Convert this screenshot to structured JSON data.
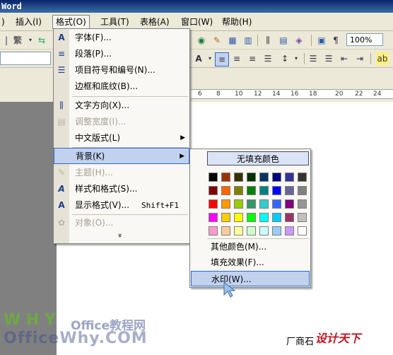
{
  "titlebar": {
    "title": "Word"
  },
  "menubar": {
    "items": [
      {
        "label": "插入(I)"
      },
      {
        "label": "格式(O)"
      },
      {
        "label": "工具(T)"
      },
      {
        "label": "表格(A)"
      },
      {
        "label": "窗口(W)"
      },
      {
        "label": "帮助(H)"
      }
    ]
  },
  "toolbar": {
    "font_variant": "繁",
    "zoom": "100%"
  },
  "ruler": {
    "ticks": [
      "6",
      "8",
      "10",
      "12",
      "14",
      "16",
      "18",
      "20",
      "22",
      "24"
    ]
  },
  "format_menu": {
    "items": [
      {
        "label": "字体(F)...",
        "icon": "font-icon",
        "glyph": "A",
        "disabled": false
      },
      {
        "label": "段落(P)...",
        "icon": "paragraph-icon",
        "glyph": "≡",
        "disabled": false
      },
      {
        "label": "项目符号和编号(N)...",
        "icon": "bullets-icon",
        "glyph": "☰",
        "disabled": false
      },
      {
        "label": "边框和底纹(B)...",
        "icon": "",
        "glyph": "",
        "disabled": false
      },
      {
        "label": "文字方向(X)...",
        "icon": "text-direction-icon",
        "glyph": "⫼",
        "disabled": false
      },
      {
        "label": "调整宽度(I)...",
        "icon": "adjust-width-icon",
        "glyph": "▤",
        "disabled": true
      },
      {
        "label": "中文版式(L)",
        "icon": "",
        "glyph": "",
        "disabled": false
      },
      {
        "label": "背景(K)",
        "icon": "",
        "glyph": "",
        "disabled": false
      },
      {
        "label": "主题(H)...",
        "icon": "theme-icon",
        "glyph": "✎",
        "disabled": true
      },
      {
        "label": "样式和格式(S)...",
        "icon": "styles-icon",
        "glyph": "A",
        "disabled": false
      },
      {
        "label": "显示格式(V)...",
        "icon": "reveal-format-icon",
        "glyph": "A",
        "disabled": false
      },
      {
        "label": "对象(O)...",
        "icon": "object-icon",
        "glyph": "✿",
        "disabled": true
      }
    ],
    "reveal_shortcut": "Shift+F1",
    "expand_glyph": "»"
  },
  "background_menu": {
    "no_fill": "无填充颜色",
    "colors": [
      [
        "#000000",
        "#993300",
        "#333300",
        "#003300",
        "#003366",
        "#000080",
        "#333399",
        "#333333"
      ],
      [
        "#800000",
        "#ff6600",
        "#808000",
        "#008000",
        "#008080",
        "#0000ff",
        "#666699",
        "#808080"
      ],
      [
        "#ff0000",
        "#ff9900",
        "#99cc00",
        "#339966",
        "#33cccc",
        "#3366ff",
        "#800080",
        "#969696"
      ],
      [
        "#ff00ff",
        "#ffcc00",
        "#ffff00",
        "#00ff00",
        "#00ffff",
        "#00ccff",
        "#993366",
        "#c0c0c0"
      ],
      [
        "#ff99cc",
        "#ffcc99",
        "#ffff99",
        "#ccffcc",
        "#ccffff",
        "#99ccff",
        "#cc99ff",
        "#ffffff"
      ]
    ],
    "more_colors": "其他颜色(M)...",
    "fill_effects": "填充效果(F)...",
    "watermark": "水印(W)..."
  },
  "watermark_site": {
    "line1": "W H Y",
    "line2": "Office教程网",
    "line3": "OfficeWhy.COM"
  },
  "document": {
    "text": "厂商石",
    "logo": "设计天下"
  }
}
